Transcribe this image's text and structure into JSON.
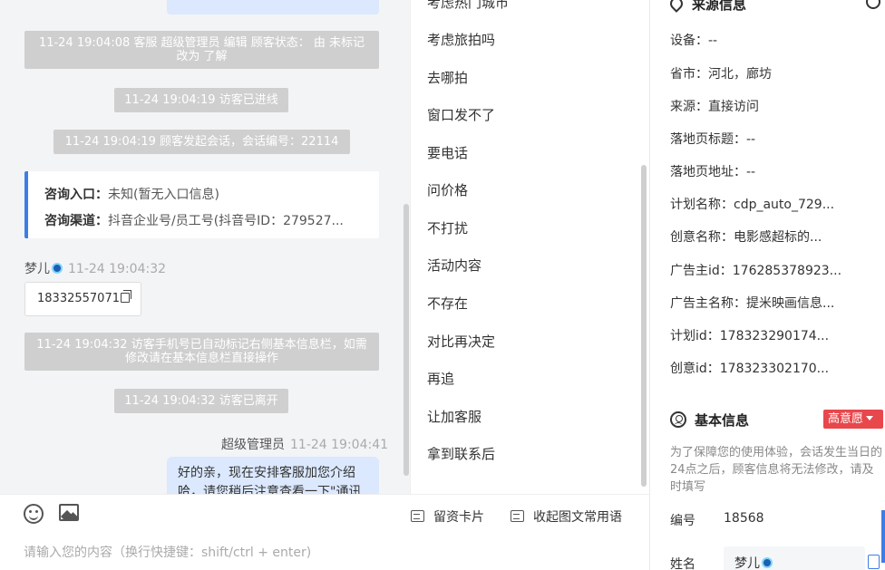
{
  "chat": {
    "events": [
      "11-24 19:04:08 客服 超级管理员 编辑 顾客状态： 由 未标记 改为 了解",
      "11-24 19:04:19 访客已进线",
      "11-24 19:04:19 顾客发起会话，会话编号：22114",
      "11-24 19:04:32 访客手机号已自动标记右侧基本信息栏，如需修改请在基本信息栏直接操作",
      "11-24 19:04:32 访客已离开"
    ],
    "consult": {
      "entry_label": "咨询入口：",
      "entry_value": "未知(暂无入口信息)",
      "channel_label": "咨询渠道：",
      "channel_value": "抖音企业号/员工号(抖音号ID：279527..."
    },
    "visitor_name": "梦儿",
    "visitor_time": "11-24 19:04:32",
    "phone": "18332557071",
    "agent_name": "超级管理员",
    "agent_time": "11-24 19:04:41",
    "agent_message": "好的亲，现在安排客服加您介绍哈，请您稍后注意查看一下\"通讯"
  },
  "input": {
    "card_button": "留资卡片",
    "collect_button": "收起图文常用语",
    "placeholder": "请输入您的内容（换行快捷键：shift/ctrl + enter)"
  },
  "quick_replies": [
    "考虑热门城市",
    "考虑旅拍吗",
    "去哪拍",
    "窗口发不了",
    "要电话",
    "问价格",
    "不打扰",
    "活动内容",
    "不存在",
    "对比再决定",
    "再追",
    "让加客服",
    "拿到联系后"
  ],
  "source_info": {
    "title": "来源信息",
    "rows": [
      "设备：--",
      "省市：河北，廊坊",
      "来源：直接访问",
      "落地页标题：--",
      "落地页地址：--",
      "计划名称：cdp_auto_729...",
      "创意名称：电影感超标的...",
      "广告主id：176285378923...",
      "广告主名称：提米映画信息...",
      "计划id：178323290174...",
      "创意id：178323302170..."
    ]
  },
  "basic_info": {
    "title": "基本信息",
    "intent_badge": "高意愿",
    "notice": "为了保障您的使用体验，会话发生当日的24点之后，顾客信息将无法修改，请及时填写",
    "id_label": "编号",
    "id_value": "18568",
    "name_label": "姓名",
    "name_value": "梦儿"
  }
}
